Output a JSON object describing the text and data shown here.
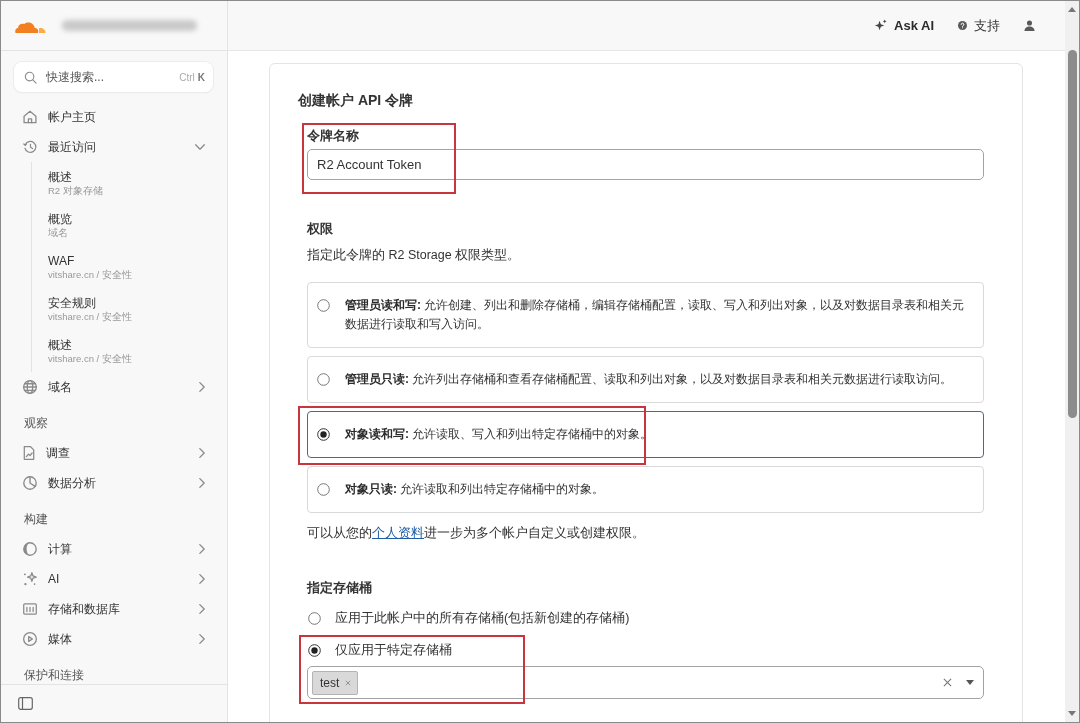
{
  "sidebar": {
    "search": {
      "placeholder": "快速搜索...",
      "shortcut_modifier": "Ctrl",
      "shortcut_key": "K"
    },
    "nav": [
      {
        "kind": "link",
        "label": "帐户主页"
      },
      {
        "kind": "group",
        "label": "最近访问",
        "expanded": true,
        "children": [
          {
            "title": "概述",
            "subtitle": "R2 对象存储"
          },
          {
            "title": "概览",
            "subtitle": "域名"
          },
          {
            "title": "WAF",
            "subtitle": "vitshare.cn / 安全性"
          },
          {
            "title": "安全规则",
            "subtitle": "vitshare.cn / 安全性"
          },
          {
            "title": "概述",
            "subtitle": "vitshare.cn / 安全性"
          }
        ]
      },
      {
        "kind": "group",
        "label": "域名",
        "expanded": false
      },
      {
        "kind": "heading",
        "label": "观察"
      },
      {
        "kind": "group",
        "label": "调查",
        "expanded": false
      },
      {
        "kind": "group",
        "label": "数据分析",
        "expanded": false
      },
      {
        "kind": "heading",
        "label": "构建"
      },
      {
        "kind": "group",
        "label": "计算",
        "expanded": false
      },
      {
        "kind": "group",
        "label": "AI",
        "expanded": false
      },
      {
        "kind": "group",
        "label": "存储和数据库",
        "expanded": false
      },
      {
        "kind": "group",
        "label": "媒体",
        "expanded": false
      },
      {
        "kind": "heading",
        "label": "保护和连接"
      }
    ]
  },
  "topbar": {
    "actions": [
      {
        "kind": "ai",
        "label": "Ask AI"
      },
      {
        "kind": "help",
        "label": "支持"
      },
      {
        "kind": "account"
      }
    ]
  },
  "form": {
    "title": "创建帐户 API 令牌",
    "token_name": {
      "label": "令牌名称",
      "value": "R2 Account Token",
      "highlighted": true
    },
    "permissions": {
      "label": "权限",
      "description": "指定此令牌的 R2 Storage 权限类型。",
      "options": [
        {
          "text": "**管理员读和写:** 允许创建、列出和删除存储桶，编辑存储桶配置，读取、写入和列出对象，以及对数据目录表和相关元数据进行读取和写入访问。",
          "selected": false,
          "highlighted": false
        },
        {
          "text": "**管理员只读:** 允许列出存储桶和查看存储桶配置、读取和列出对象，以及对数据目录表和相关元数据进行读取访问。",
          "selected": false,
          "highlighted": false
        },
        {
          "text": "**对象读和写:** 允许读取、写入和列出特定存储桶中的对象。",
          "selected": true,
          "highlighted": true
        },
        {
          "text": "**对象只读:** 允许读取和列出特定存储桶中的对象。",
          "selected": false,
          "highlighted": false
        }
      ],
      "note": {
        "before": "可以从您的",
        "link": "个人资料",
        "after": "进一步为多个帐户自定义或创建权限。"
      }
    },
    "buckets": {
      "label": "指定存储桶",
      "options": [
        {
          "label": "应用于此帐户中的所有存储桶(包括新创建的存储桶)",
          "selected": false
        },
        {
          "label": "仅应用于特定存储桶",
          "selected": true
        }
      ],
      "selected_buckets": [
        {
          "label": "test"
        }
      ],
      "highlighted": true
    }
  }
}
